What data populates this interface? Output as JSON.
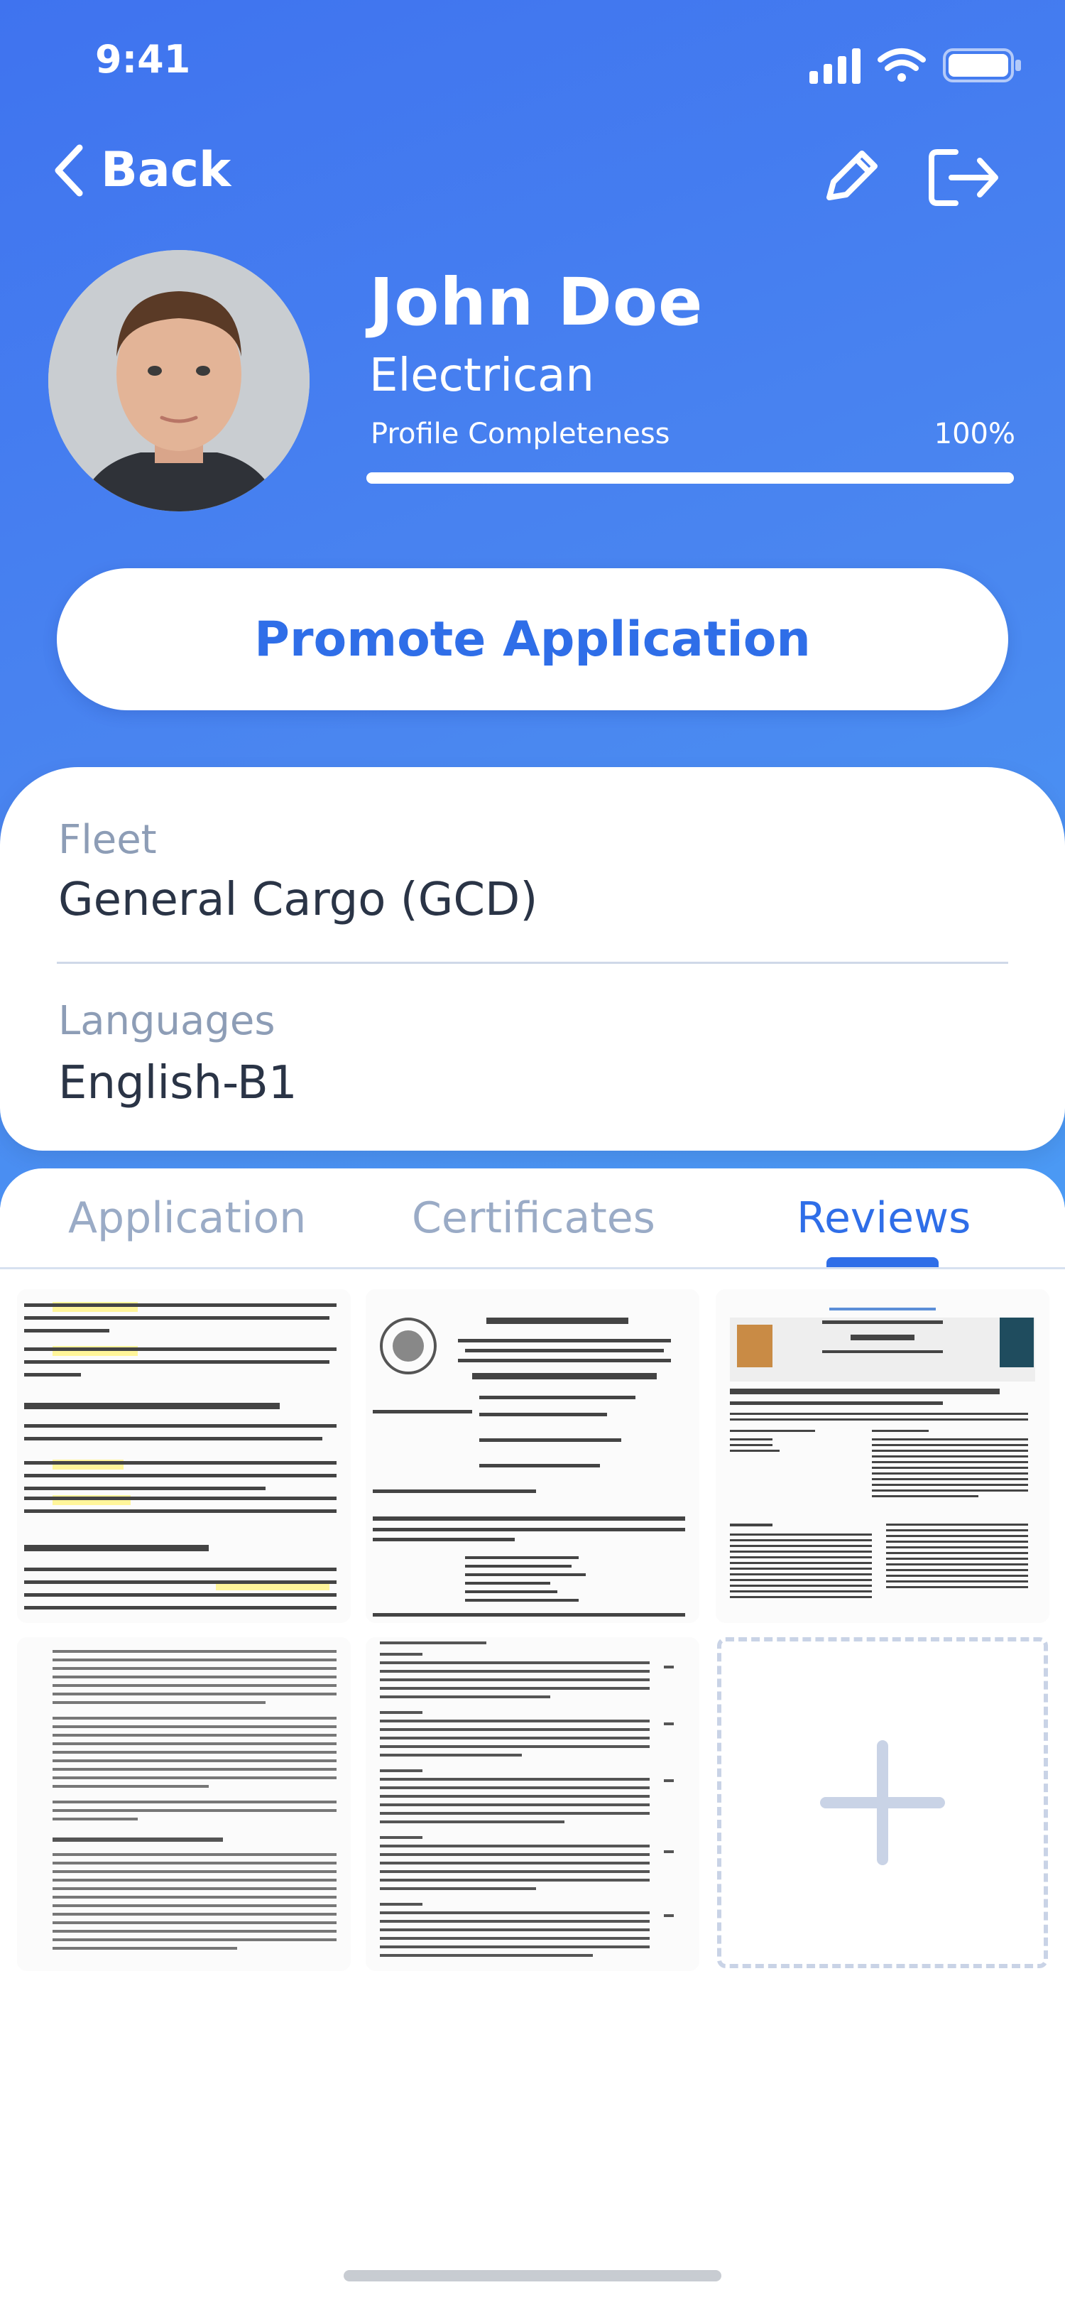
{
  "status_bar": {
    "time": "9:41"
  },
  "nav": {
    "back_label": "Back"
  },
  "profile": {
    "name": "John Doe",
    "role": "Electrican",
    "completeness_label": "Profile Completeness",
    "completeness_value": "100%",
    "completeness_fraction": 1.0
  },
  "actions": {
    "promote_label": "Promote Application"
  },
  "info": {
    "fleet_label": "Fleet",
    "fleet_value": "General Cargo (GCD)",
    "languages_label": "Languages",
    "languages_value": "English-B1"
  },
  "tabs": [
    {
      "label": "Application",
      "active": false
    },
    {
      "label": "Certificates",
      "active": false
    },
    {
      "label": "Reviews",
      "active": true
    }
  ],
  "documents": [
    {
      "icon": "document-thumbnail"
    },
    {
      "icon": "document-thumbnail"
    },
    {
      "icon": "document-thumbnail"
    },
    {
      "icon": "document-thumbnail"
    },
    {
      "icon": "document-thumbnail"
    }
  ],
  "colors": {
    "accent": "#2f6ee8",
    "header_gradient_start": "#3f73ef",
    "header_gradient_end": "#4b9af4",
    "muted_text": "#8d9db6",
    "body_text": "#2a3446"
  }
}
